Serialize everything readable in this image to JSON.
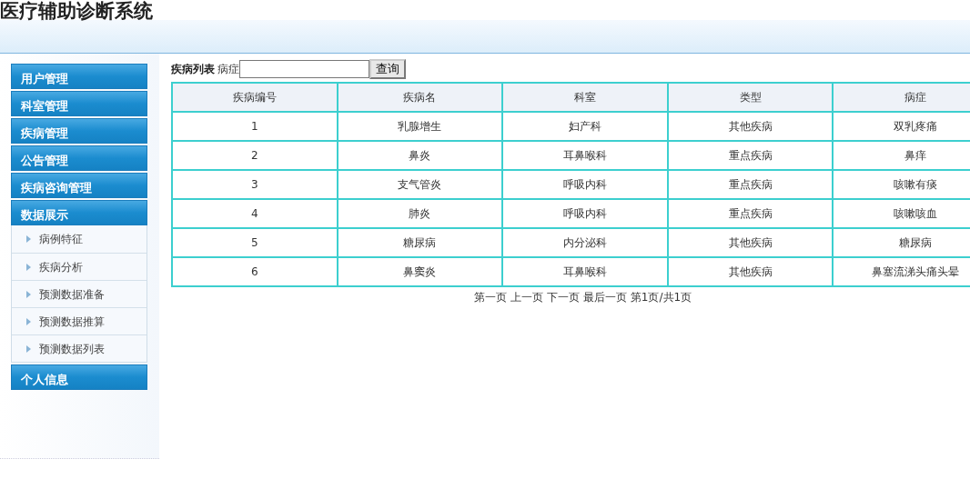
{
  "app_title": "医疗辅助诊断系统",
  "sidebar": {
    "groups": [
      {
        "label": "用户管理"
      },
      {
        "label": "科室管理"
      },
      {
        "label": "疾病管理"
      },
      {
        "label": "公告管理"
      },
      {
        "label": "疾病咨询管理"
      },
      {
        "label": "数据展示",
        "children": [
          {
            "label": "病例特征"
          },
          {
            "label": "疾病分析"
          },
          {
            "label": "预测数据准备"
          },
          {
            "label": "预测数据推算"
          },
          {
            "label": "预测数据列表"
          }
        ]
      },
      {
        "label": "个人信息"
      }
    ]
  },
  "search": {
    "title": "疾病列表",
    "label": "病症",
    "button": "查询"
  },
  "table": {
    "columns": [
      "疾病编号",
      "疾病名",
      "科室",
      "类型",
      "病症"
    ],
    "rows": [
      [
        "1",
        "乳腺增生",
        "妇产科",
        "其他疾病",
        "双乳疼痛"
      ],
      [
        "2",
        "鼻炎",
        "耳鼻喉科",
        "重点疾病",
        "鼻痒"
      ],
      [
        "3",
        "支气管炎",
        "呼吸内科",
        "重点疾病",
        "咳嗽有痰"
      ],
      [
        "4",
        "肺炎",
        "呼吸内科",
        "重点疾病",
        "咳嗽咳血"
      ],
      [
        "5",
        "糖尿病",
        "内分泌科",
        "其他疾病",
        "糖尿病"
      ],
      [
        "6",
        "鼻窦炎",
        "耳鼻喉科",
        "其他疾病",
        "鼻塞流涕头痛头晕"
      ]
    ]
  },
  "pagination": [
    "第一页",
    "上一页",
    "下一页",
    "最后一页",
    "第1页/共1页"
  ]
}
